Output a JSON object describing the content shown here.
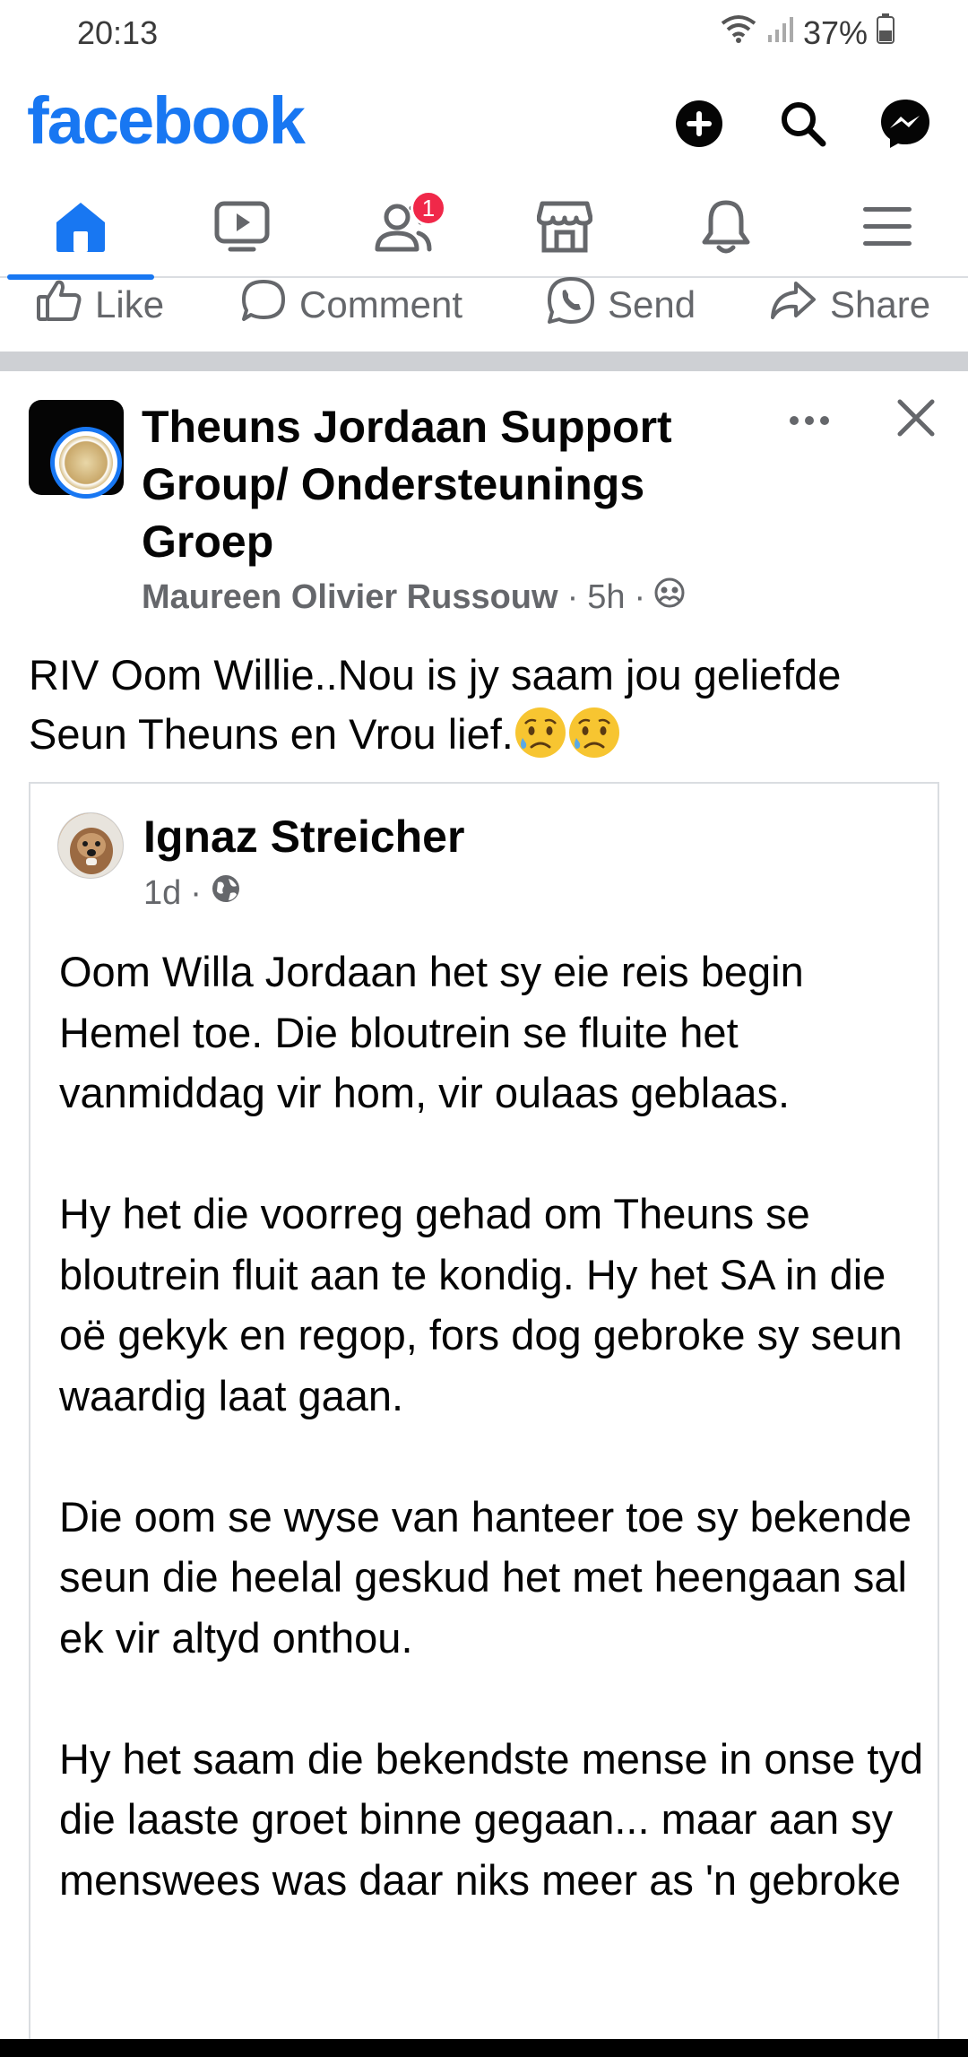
{
  "status_bar": {
    "time": "20:13",
    "battery": "37%"
  },
  "header": {
    "logo": "facebook",
    "buttons": [
      {
        "name": "create-icon"
      },
      {
        "name": "search-icon"
      },
      {
        "name": "messenger-icon"
      }
    ],
    "colors": {
      "brand": "#1877f2",
      "badge": "#f02849",
      "muted": "#65676b"
    }
  },
  "nav": {
    "tabs": [
      {
        "name": "home-icon",
        "active": true
      },
      {
        "name": "video-icon"
      },
      {
        "name": "friends-icon",
        "badge": "1"
      },
      {
        "name": "marketplace-icon"
      },
      {
        "name": "notifications-icon"
      },
      {
        "name": "menu-icon"
      }
    ]
  },
  "actions": {
    "like": "Like",
    "comment": "Comment",
    "send": "Send",
    "share": "Share"
  },
  "post": {
    "group_name": "Theuns Jordaan Support Group/ Ondersteunings Groep",
    "author": "Maureen Olivier Russouw",
    "time": "5h",
    "text": "RIV Oom Willie..Nou is jy saam jou geliefde Seun Theuns en Vrou lief."
  },
  "shared_post": {
    "author": "Ignaz Streicher",
    "time": "1d",
    "paragraphs": [
      "Oom Willa Jordaan het sy eie reis begin Hemel toe. Die bloutrein se fluite het vanmiddag vir hom, vir oulaas geblaas.",
      "Hy het die voorreg gehad om Theuns se bloutrein fluit aan te kondig. Hy het SA in die oë gekyk en regop, fors dog gebroke sy seun waardig laat gaan.",
      "Die oom se wyse van hanteer toe sy bekende seun die heelal geskud het met heengaan sal ek vir altyd onthou.",
      "Hy het saam die bekendste mense in onse tyd die laaste groet binne gegaan... maar aan sy menswees was daar niks meer as 'n gebroke"
    ]
  }
}
